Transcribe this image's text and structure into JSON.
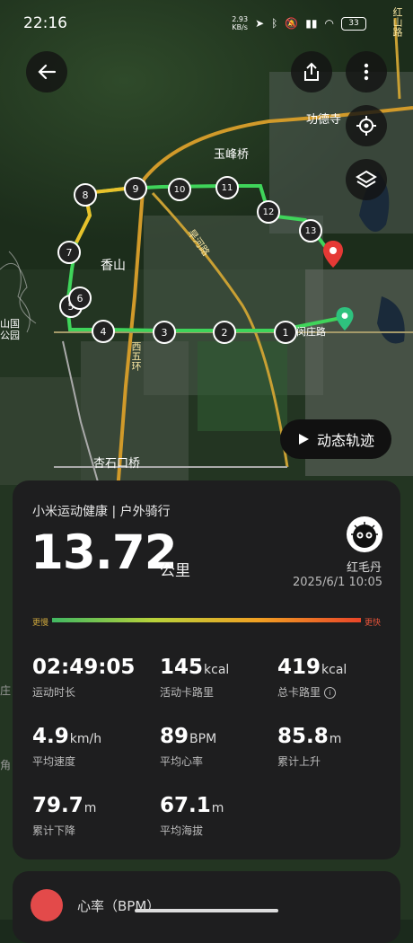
{
  "status_bar": {
    "time": "22:16",
    "net_speed_value": "2.93",
    "net_speed_unit": "KB/s",
    "battery": "33"
  },
  "map": {
    "place_labels": [
      "功德寺",
      "玉峰桥",
      "香山",
      "杏石口桥",
      "闵庄路",
      "西五环",
      "旱河路",
      "红山路",
      "山国公园",
      "角",
      "庄"
    ],
    "waypoints": [
      "1",
      "2",
      "3",
      "4",
      "5",
      "6",
      "7",
      "8",
      "9",
      "10",
      "11",
      "12",
      "13"
    ],
    "playback_button": "动态轨迹"
  },
  "workout": {
    "source": "小米运动健康 | 户外骑行",
    "distance_value": "13.72",
    "distance_unit": "公里",
    "user_name": "红毛丹",
    "datetime": "2025/6/1 10:05",
    "slow_label": "更慢",
    "fast_label": "更快",
    "stats": [
      {
        "value": "02:49:05",
        "unit": "",
        "label": "运动时长"
      },
      {
        "value": "145",
        "unit": "kcal",
        "label": "活动卡路里"
      },
      {
        "value": "419",
        "unit": "kcal",
        "label": "总卡路里"
      },
      {
        "value": "4.9",
        "unit": "km/h",
        "label": "平均速度"
      },
      {
        "value": "89",
        "unit": "BPM",
        "label": "平均心率"
      },
      {
        "value": "85.8",
        "unit": "m",
        "label": "累计上升"
      },
      {
        "value": "79.7",
        "unit": "m",
        "label": "累计下降"
      },
      {
        "value": "67.1",
        "unit": "m",
        "label": "平均海拔"
      }
    ]
  },
  "next_card": {
    "title": "心率（BPM）"
  },
  "colors": {
    "route_green": "#3fd45a",
    "route_yellow": "#e8c12b",
    "start_marker": "#2ec27e",
    "end_marker": "#e53935"
  }
}
